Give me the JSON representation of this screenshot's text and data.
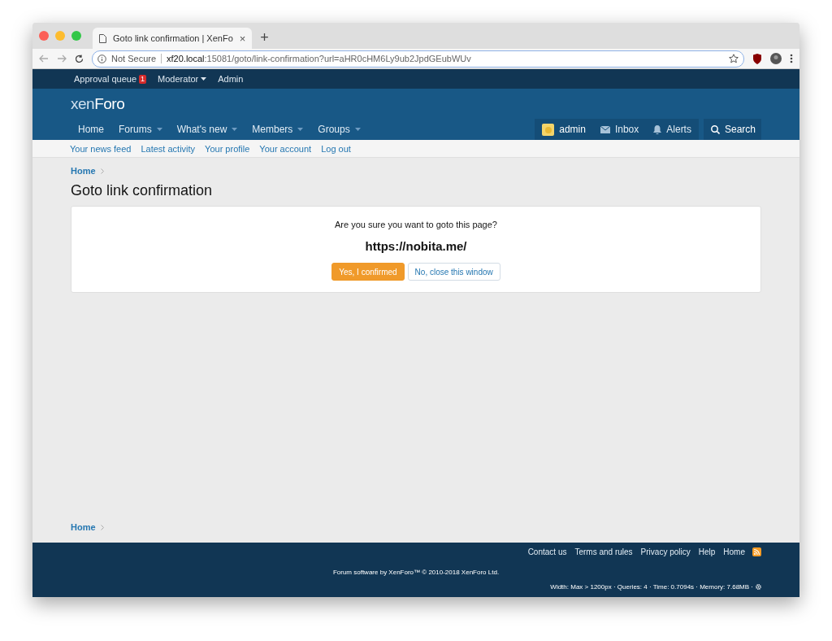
{
  "browser": {
    "tab_title": "Goto link confirmation | XenFo",
    "tab_close": "×",
    "new_tab": "+",
    "security": "Not Secure",
    "url_host": "xf20.local",
    "url_path": ":15081/goto/link-confirmation?url=aHR0cHM6Ly9ub2JpdGEubWUv"
  },
  "staff_bar": [
    {
      "label": "Approval queue",
      "badge": "1",
      "has_menu": false
    },
    {
      "label": "Moderator",
      "has_menu": true
    },
    {
      "label": "Admin",
      "has_menu": false
    }
  ],
  "logo": {
    "light": "xen",
    "bold": "Foro"
  },
  "nav": [
    {
      "label": "Home",
      "has_menu": false
    },
    {
      "label": "Forums",
      "has_menu": true
    },
    {
      "label": "What's new",
      "has_menu": true
    },
    {
      "label": "Members",
      "has_menu": true
    },
    {
      "label": "Groups",
      "has_menu": true
    }
  ],
  "user_nav": [
    {
      "kind": "avatar",
      "label": "admin"
    },
    {
      "kind": "inbox",
      "label": "Inbox"
    },
    {
      "kind": "alerts",
      "label": "Alerts"
    },
    {
      "kind": "search",
      "label": "Search"
    }
  ],
  "sub_nav": [
    "Your news feed",
    "Latest activity",
    "Your profile",
    "Your account",
    "Log out"
  ],
  "breadcrumb_top": [
    "Home"
  ],
  "title": "Goto link confirmation",
  "confirm": {
    "question": "Are you sure you want to goto this page?",
    "url": "https://nobita.me/",
    "buttons": [
      {
        "label": "Yes, I confirmed",
        "kind": "primary"
      },
      {
        "label": "No, close this window",
        "kind": "secondary"
      }
    ]
  },
  "breadcrumb_bottom": [
    "Home"
  ],
  "footer": {
    "links": [
      "Contact us",
      "Terms and rules",
      "Privacy policy",
      "Help",
      "Home"
    ],
    "copyright": "Forum software by XenForo™ © 2010-2018 XenForo Ltd.",
    "debug": "Width: Max > 1200px · Queries: 4 · Time: 0.7094s · Memory: 7.68MB ·"
  }
}
